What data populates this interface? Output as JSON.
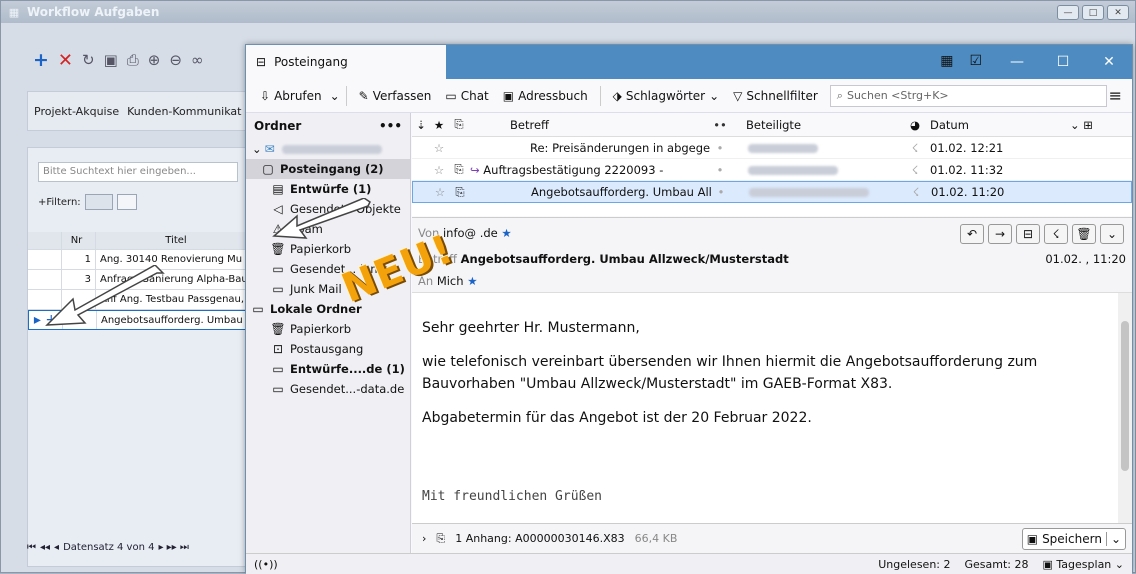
{
  "bg": {
    "title": "Workflow Aufgaben",
    "nav": [
      "Projekt-Akquise",
      "Kunden-Kommunikat"
    ],
    "search_placeholder": "Bitte Suchtext hier eingeben...",
    "filter_label": "+Filtern:",
    "grid_headers": [
      "Nr",
      "Titel"
    ],
    "rows": [
      {
        "n": "1",
        "t": "Ang. 30140 Renovierung Mu"
      },
      {
        "n": "3",
        "t": "Anfrage Sanierung Alpha-Bau"
      },
      {
        "n": "",
        "t": "Anf Ang. Testbau Passgenau,"
      },
      {
        "n": "",
        "t": "Angebotsaufforderg. Umbau"
      }
    ],
    "footer": "Datensatz 4 von 4"
  },
  "tb": {
    "tab_title": "Posteingang",
    "toolbar": {
      "get": "Abrufen",
      "write": "Verfassen",
      "chat": "Chat",
      "addr": "Adressbuch",
      "tags": "Schlagwörter",
      "filter": "Schnellfilter",
      "search": "Suchen <Strg+K>"
    },
    "folders_title": "Ordner",
    "folders": [
      {
        "l": "Posteingang (2)",
        "b": true,
        "sel": true,
        "i": "▢",
        "ind": 14
      },
      {
        "l": "Entwürfe (1)",
        "b": true,
        "i": "▤",
        "ind": 24
      },
      {
        "l": "Gesendete Objekte",
        "i": "◁",
        "ind": 24
      },
      {
        "l": "Spam",
        "i": "⚠",
        "ind": 24
      },
      {
        "l": "Papierkorb",
        "i": "🗑",
        "ind": 24
      },
      {
        "l": "Gesendet... Ionen",
        "i": "▭",
        "ind": 24
      },
      {
        "l": "Junk Mail",
        "i": "▭",
        "ind": 24
      },
      {
        "l": "Lokale Ordner",
        "b": true,
        "i": "▭",
        "ind": 4
      },
      {
        "l": "Papierkorb",
        "i": "🗑",
        "ind": 24
      },
      {
        "l": "Postausgang",
        "i": "⊡",
        "ind": 24
      },
      {
        "l": "Entwürfe....de (1)",
        "b": true,
        "i": "▭",
        "ind": 24
      },
      {
        "l": "Gesendet...-data.de",
        "i": "▭",
        "ind": 24
      }
    ],
    "cols": {
      "subject": "Betreff",
      "corr": "Beteiligte",
      "date": "Datum"
    },
    "messages": [
      {
        "s": "Re:  Preisänderungen in abgegebenen ...",
        "d": "01.02.      12:21"
      },
      {
        "s": "Auftragsbestätigung 2220093 - ",
        "d": "01.02.      11:32"
      },
      {
        "s": "Angebotsaufforderg. Umbau Allzweck/Mu...",
        "d": "01.02.      11:20"
      }
    ],
    "from_label": "Von",
    "from": "info@                     .de",
    "subject_label": "Betreff",
    "subject": "Angebotsaufforderg. Umbau Allzweck/Musterstadt",
    "date": "01.02.       , 11:20",
    "to_label": "An",
    "to": "Mich",
    "body": [
      "Sehr geehrter Hr. Mustermann,",
      "wie telefonisch vereinbart übersenden wir Ihnen hiermit die Angebotsaufforderung zum Bauvorhaben \"Umbau Allzweck/Musterstadt\" im GAEB-Format X83.",
      "Abgabetermin für das Angebot ist der 20 Februar 2022."
    ],
    "signature": "Mit freundlichen Grüßen",
    "attachment": "1 Anhang: A00000030146.X83",
    "attachment_size": "66,4 KB",
    "save": "Speichern",
    "status": {
      "unread": "Ungelesen: 2",
      "total": "Gesamt: 28",
      "plan": "Tagesplan"
    }
  },
  "overlay": "NEU!"
}
